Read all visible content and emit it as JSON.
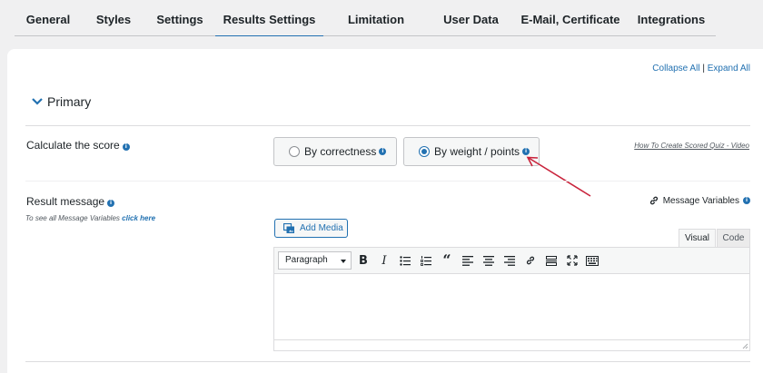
{
  "tabs": [
    {
      "label": "General"
    },
    {
      "label": "Styles"
    },
    {
      "label": "Settings"
    },
    {
      "label": "Results Settings",
      "active": true
    },
    {
      "label": "Limitation Users"
    },
    {
      "label": "User Data"
    },
    {
      "label": "E-Mail, Certificate"
    },
    {
      "label": "Integrations"
    }
  ],
  "links": {
    "collapse_all": "Collapse All",
    "separator": "|",
    "expand_all": "Expand All"
  },
  "section": {
    "title": "Primary"
  },
  "score": {
    "label": "Calculate the score",
    "option_correctness": "By correctness",
    "option_weight": "By weight / points",
    "selected": "By weight / points",
    "video_link": "How To Create Scored Quiz - Video"
  },
  "result_message": {
    "label": "Result message",
    "hint_prefix": "To see all Message Variables",
    "hint_link": "click here",
    "message_variables": "Message Variables",
    "add_media": "Add Media",
    "tab_visual": "Visual",
    "tab_code": "Code",
    "format_value": "Paragraph"
  },
  "colors": {
    "accent": "#2271b1",
    "arrow": "#c9243c"
  }
}
